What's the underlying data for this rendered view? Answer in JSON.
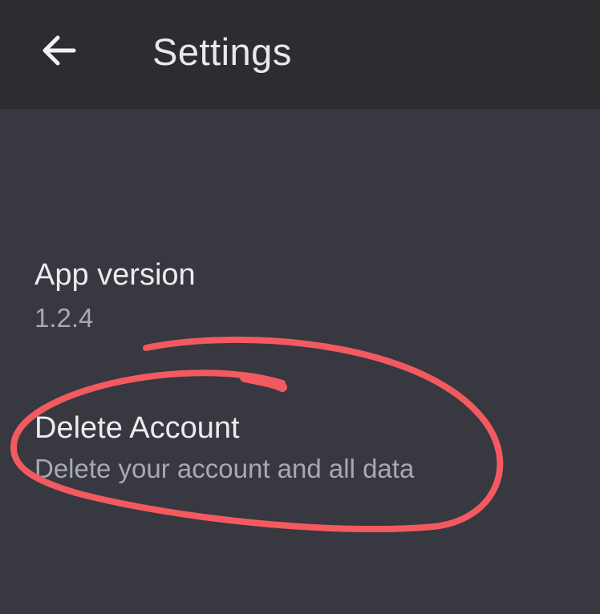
{
  "app_bar": {
    "back_icon": "arrow-left-icon",
    "title": "Settings"
  },
  "settings": {
    "items": [
      {
        "title": "App version",
        "summary": "1.2.4"
      },
      {
        "title": "Delete Account",
        "summary": "Delete your account and all data"
      }
    ]
  },
  "colors": {
    "app_bar_background": "#2c2d31",
    "page_background": "#373840",
    "title_text": "#ececef",
    "summary_text": "#a9aab0",
    "annotation": "#f25a5f"
  }
}
